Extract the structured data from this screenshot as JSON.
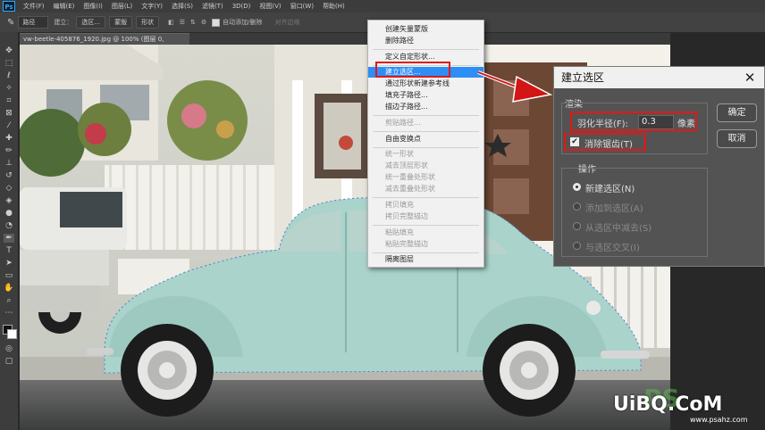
{
  "menubar": {
    "logo": "Ps",
    "items": [
      "文件(F)",
      "编辑(E)",
      "图像(I)",
      "图层(L)",
      "文字(Y)",
      "选择(S)",
      "滤镜(T)",
      "3D(D)",
      "视图(V)",
      "窗口(W)",
      "帮助(H)"
    ]
  },
  "options": {
    "mode": "路径",
    "build_label": "建立：",
    "selection_btn": "选区...",
    "mask_btn": "蒙版",
    "shape_btn": "形状",
    "auto_add_label": "自动添加/删除",
    "align_edges": "对齐边缘"
  },
  "document": {
    "tab_title": "vw-beetle-405876_1920.jpg @ 100% (图层 0, RGB/8#) *"
  },
  "context_menu": {
    "items": [
      {
        "label": "创建矢量蒙版",
        "disabled": false
      },
      {
        "label": "删除路径",
        "disabled": false
      },
      {
        "label": "定义自定形状...",
        "disabled": false
      },
      {
        "label": "建立选区...",
        "disabled": false,
        "highlighted": true
      },
      {
        "label": "通过形状新建参考线",
        "disabled": false
      },
      {
        "label": "填充子路径...",
        "disabled": false
      },
      {
        "label": "描边子路径...",
        "disabled": false
      },
      {
        "label": "剪贴路径...",
        "disabled": true
      },
      {
        "label": "自由变换点",
        "disabled": false
      },
      {
        "label": "统一形状",
        "disabled": true
      },
      {
        "label": "减去顶层形状",
        "disabled": true
      },
      {
        "label": "统一重叠处形状",
        "disabled": true
      },
      {
        "label": "减去重叠处形状",
        "disabled": true
      },
      {
        "label": "拷贝填充",
        "disabled": true
      },
      {
        "label": "拷贝完整描边",
        "disabled": true
      },
      {
        "label": "粘贴填充",
        "disabled": true
      },
      {
        "label": "粘贴完整描边",
        "disabled": true
      },
      {
        "label": "隔离图层",
        "disabled": false
      }
    ]
  },
  "dialog": {
    "title": "建立选区",
    "render_group": "渲染",
    "feather_label": "羽化半径(F):",
    "feather_value": "0.3",
    "feather_unit": "像素",
    "antialias_label": "消除锯齿(T)",
    "antialias_checked": true,
    "operation_group": "操作",
    "ops": [
      {
        "label": "新建选区(N)",
        "selected": true,
        "disabled": false
      },
      {
        "label": "添加到选区(A)",
        "selected": false,
        "disabled": true
      },
      {
        "label": "从选区中减去(S)",
        "selected": false,
        "disabled": true
      },
      {
        "label": "与选区交叉(I)",
        "selected": false,
        "disabled": true
      }
    ],
    "ok_label": "确定",
    "cancel_label": "取消"
  },
  "watermark": {
    "brand": "UiBQ.CoM",
    "site": "www.psahz.com",
    "overlay": "PS"
  },
  "colors": {
    "highlight": "#2e8ef5",
    "annotation_red": "#e11818",
    "car": "#a9d3cb"
  }
}
